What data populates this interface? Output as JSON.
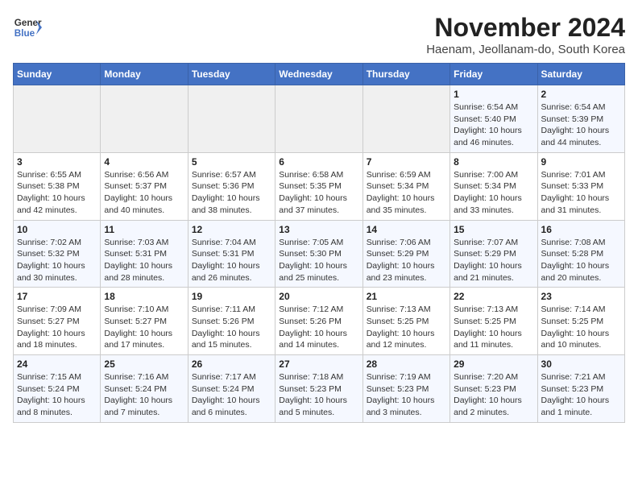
{
  "logo": {
    "line1": "General",
    "line2": "Blue"
  },
  "title": "November 2024",
  "subtitle": "Haenam, Jeollanam-do, South Korea",
  "weekdays": [
    "Sunday",
    "Monday",
    "Tuesday",
    "Wednesday",
    "Thursday",
    "Friday",
    "Saturday"
  ],
  "weeks": [
    [
      {
        "day": "",
        "info": ""
      },
      {
        "day": "",
        "info": ""
      },
      {
        "day": "",
        "info": ""
      },
      {
        "day": "",
        "info": ""
      },
      {
        "day": "",
        "info": ""
      },
      {
        "day": "1",
        "info": "Sunrise: 6:54 AM\nSunset: 5:40 PM\nDaylight: 10 hours\nand 46 minutes."
      },
      {
        "day": "2",
        "info": "Sunrise: 6:54 AM\nSunset: 5:39 PM\nDaylight: 10 hours\nand 44 minutes."
      }
    ],
    [
      {
        "day": "3",
        "info": "Sunrise: 6:55 AM\nSunset: 5:38 PM\nDaylight: 10 hours\nand 42 minutes."
      },
      {
        "day": "4",
        "info": "Sunrise: 6:56 AM\nSunset: 5:37 PM\nDaylight: 10 hours\nand 40 minutes."
      },
      {
        "day": "5",
        "info": "Sunrise: 6:57 AM\nSunset: 5:36 PM\nDaylight: 10 hours\nand 38 minutes."
      },
      {
        "day": "6",
        "info": "Sunrise: 6:58 AM\nSunset: 5:35 PM\nDaylight: 10 hours\nand 37 minutes."
      },
      {
        "day": "7",
        "info": "Sunrise: 6:59 AM\nSunset: 5:34 PM\nDaylight: 10 hours\nand 35 minutes."
      },
      {
        "day": "8",
        "info": "Sunrise: 7:00 AM\nSunset: 5:34 PM\nDaylight: 10 hours\nand 33 minutes."
      },
      {
        "day": "9",
        "info": "Sunrise: 7:01 AM\nSunset: 5:33 PM\nDaylight: 10 hours\nand 31 minutes."
      }
    ],
    [
      {
        "day": "10",
        "info": "Sunrise: 7:02 AM\nSunset: 5:32 PM\nDaylight: 10 hours\nand 30 minutes."
      },
      {
        "day": "11",
        "info": "Sunrise: 7:03 AM\nSunset: 5:31 PM\nDaylight: 10 hours\nand 28 minutes."
      },
      {
        "day": "12",
        "info": "Sunrise: 7:04 AM\nSunset: 5:31 PM\nDaylight: 10 hours\nand 26 minutes."
      },
      {
        "day": "13",
        "info": "Sunrise: 7:05 AM\nSunset: 5:30 PM\nDaylight: 10 hours\nand 25 minutes."
      },
      {
        "day": "14",
        "info": "Sunrise: 7:06 AM\nSunset: 5:29 PM\nDaylight: 10 hours\nand 23 minutes."
      },
      {
        "day": "15",
        "info": "Sunrise: 7:07 AM\nSunset: 5:29 PM\nDaylight: 10 hours\nand 21 minutes."
      },
      {
        "day": "16",
        "info": "Sunrise: 7:08 AM\nSunset: 5:28 PM\nDaylight: 10 hours\nand 20 minutes."
      }
    ],
    [
      {
        "day": "17",
        "info": "Sunrise: 7:09 AM\nSunset: 5:27 PM\nDaylight: 10 hours\nand 18 minutes."
      },
      {
        "day": "18",
        "info": "Sunrise: 7:10 AM\nSunset: 5:27 PM\nDaylight: 10 hours\nand 17 minutes."
      },
      {
        "day": "19",
        "info": "Sunrise: 7:11 AM\nSunset: 5:26 PM\nDaylight: 10 hours\nand 15 minutes."
      },
      {
        "day": "20",
        "info": "Sunrise: 7:12 AM\nSunset: 5:26 PM\nDaylight: 10 hours\nand 14 minutes."
      },
      {
        "day": "21",
        "info": "Sunrise: 7:13 AM\nSunset: 5:25 PM\nDaylight: 10 hours\nand 12 minutes."
      },
      {
        "day": "22",
        "info": "Sunrise: 7:13 AM\nSunset: 5:25 PM\nDaylight: 10 hours\nand 11 minutes."
      },
      {
        "day": "23",
        "info": "Sunrise: 7:14 AM\nSunset: 5:25 PM\nDaylight: 10 hours\nand 10 minutes."
      }
    ],
    [
      {
        "day": "24",
        "info": "Sunrise: 7:15 AM\nSunset: 5:24 PM\nDaylight: 10 hours\nand 8 minutes."
      },
      {
        "day": "25",
        "info": "Sunrise: 7:16 AM\nSunset: 5:24 PM\nDaylight: 10 hours\nand 7 minutes."
      },
      {
        "day": "26",
        "info": "Sunrise: 7:17 AM\nSunset: 5:24 PM\nDaylight: 10 hours\nand 6 minutes."
      },
      {
        "day": "27",
        "info": "Sunrise: 7:18 AM\nSunset: 5:23 PM\nDaylight: 10 hours\nand 5 minutes."
      },
      {
        "day": "28",
        "info": "Sunrise: 7:19 AM\nSunset: 5:23 PM\nDaylight: 10 hours\nand 3 minutes."
      },
      {
        "day": "29",
        "info": "Sunrise: 7:20 AM\nSunset: 5:23 PM\nDaylight: 10 hours\nand 2 minutes."
      },
      {
        "day": "30",
        "info": "Sunrise: 7:21 AM\nSunset: 5:23 PM\nDaylight: 10 hours\nand 1 minute."
      }
    ]
  ]
}
